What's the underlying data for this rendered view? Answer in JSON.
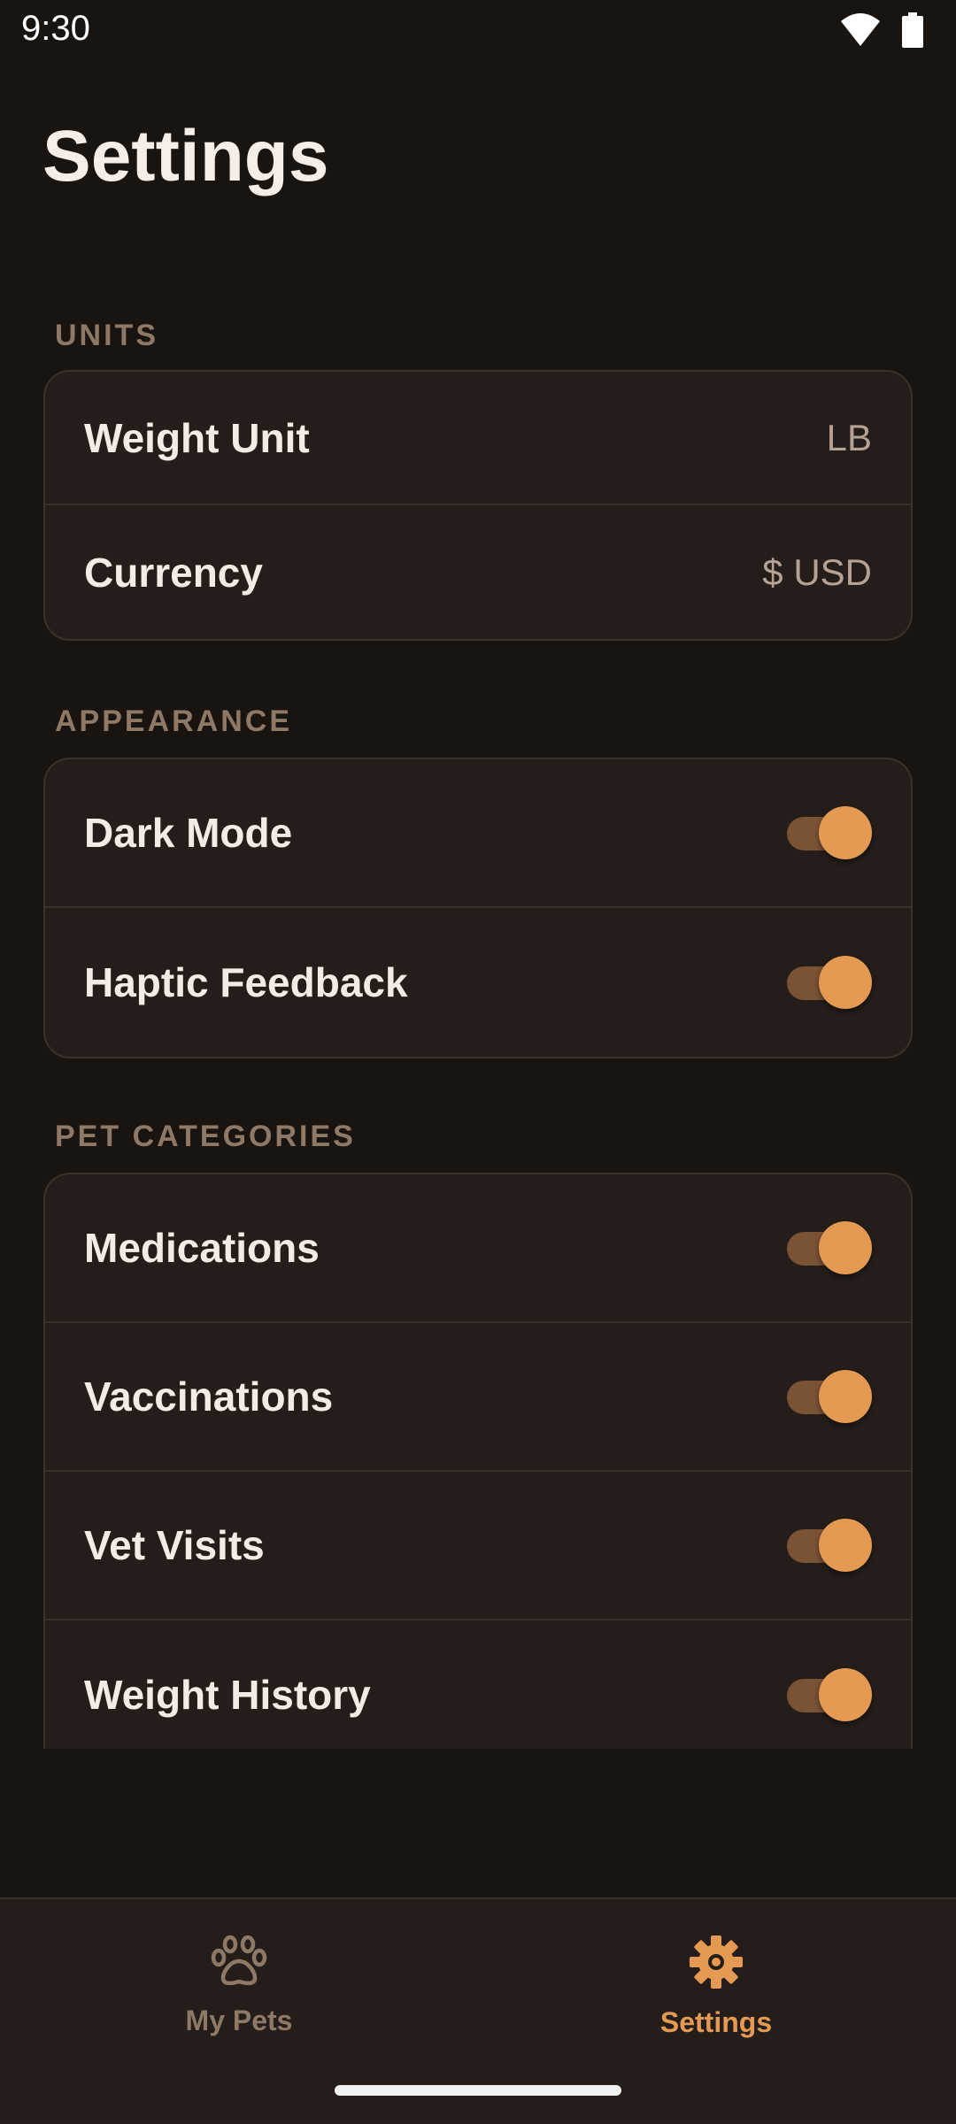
{
  "status_bar": {
    "time": "9:30",
    "icons": [
      "wifi-icon",
      "battery-icon"
    ]
  },
  "header": {
    "title": "Settings"
  },
  "sections": {
    "units": {
      "label": "UNITS",
      "rows": [
        {
          "label": "Weight Unit",
          "value": "LB"
        },
        {
          "label": "Currency",
          "value": "$ USD"
        }
      ]
    },
    "appearance": {
      "label": "APPEARANCE",
      "rows": [
        {
          "label": "Dark Mode",
          "enabled": true
        },
        {
          "label": "Haptic Feedback",
          "enabled": true
        }
      ]
    },
    "pet_categories": {
      "label": "PET CATEGORIES",
      "rows": [
        {
          "label": "Medications",
          "enabled": true
        },
        {
          "label": "Vaccinations",
          "enabled": true
        },
        {
          "label": "Vet Visits",
          "enabled": true
        },
        {
          "label": "Weight History",
          "enabled": true
        }
      ]
    }
  },
  "bottom_nav": {
    "items": [
      {
        "label": "My Pets",
        "icon": "paw-icon",
        "active": false
      },
      {
        "label": "Settings",
        "icon": "gear-icon",
        "active": true
      }
    ]
  },
  "colors": {
    "background": "#1a1411",
    "card": "#241d19",
    "accent": "#e49a52",
    "toggle_track": "#7a5235",
    "section_label": "#8e7866"
  }
}
